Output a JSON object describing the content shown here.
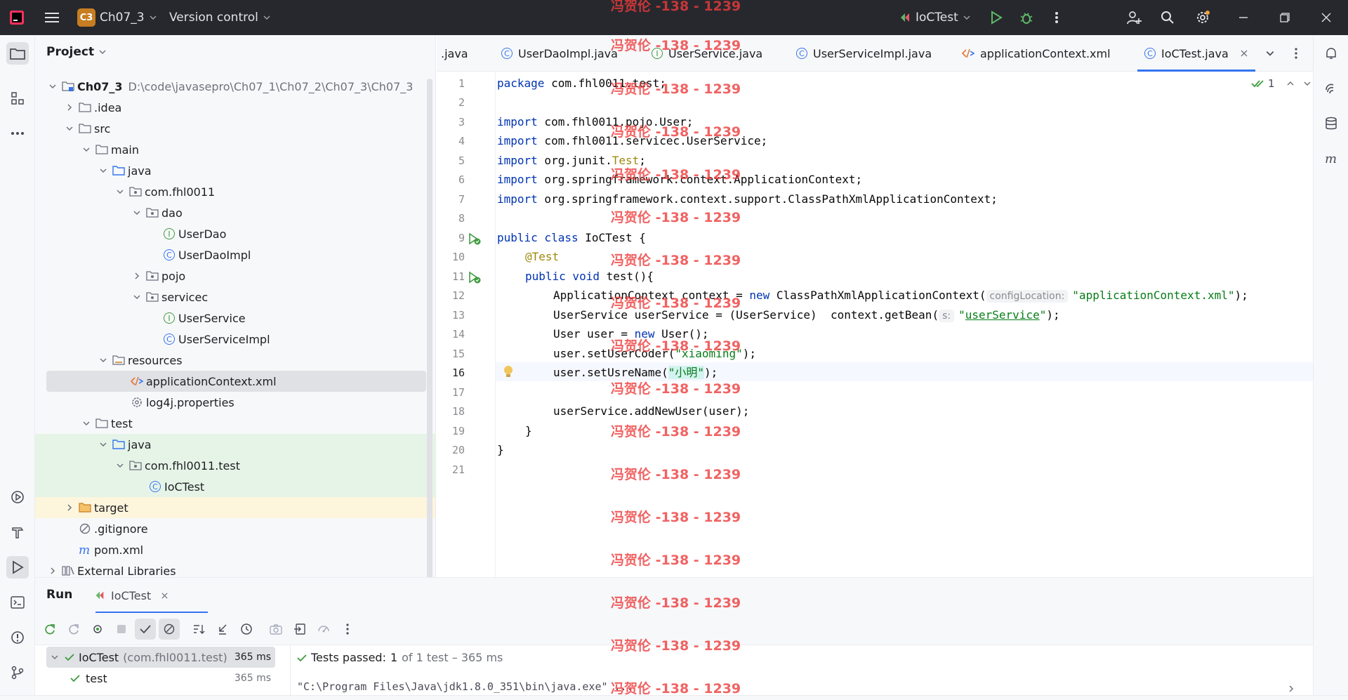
{
  "titlebar": {
    "project_badge": "C3",
    "project_name": "Ch07_3",
    "vcs_label": "Version control",
    "run_config": "IoCTest"
  },
  "project_panel": {
    "title": "Project",
    "tree": [
      {
        "label": "Ch07_3",
        "path": "D:\\code\\javasepro\\Ch07_1\\Ch07_2\\Ch07_3\\Ch07_3"
      },
      {
        "label": ".idea"
      },
      {
        "label": "src"
      },
      {
        "label": "main"
      },
      {
        "label": "java"
      },
      {
        "label": "com.fhl0011"
      },
      {
        "label": "dao"
      },
      {
        "label": "UserDao"
      },
      {
        "label": "UserDaoImpl"
      },
      {
        "label": "pojo"
      },
      {
        "label": "servicec"
      },
      {
        "label": "UserService"
      },
      {
        "label": "UserServiceImpl"
      },
      {
        "label": "resources"
      },
      {
        "label": "applicationContext.xml"
      },
      {
        "label": "log4j.properties"
      },
      {
        "label": "test"
      },
      {
        "label": "java"
      },
      {
        "label": "com.fhl0011.test"
      },
      {
        "label": "IoCTest"
      },
      {
        "label": "target"
      },
      {
        "label": ".gitignore"
      },
      {
        "label": "pom.xml"
      },
      {
        "label": "External Libraries"
      }
    ]
  },
  "editor": {
    "tabs": [
      {
        "label": ".java"
      },
      {
        "label": "UserDaoImpl.java"
      },
      {
        "label": "UserService.java"
      },
      {
        "label": "UserServiceImpl.java"
      },
      {
        "label": "applicationContext.xml"
      },
      {
        "label": "IoCTest.java"
      }
    ],
    "inspection_count": "1",
    "line_numbers": [
      "1",
      "2",
      "3",
      "4",
      "5",
      "6",
      "7",
      "8",
      "9",
      "10",
      "11",
      "12",
      "13",
      "14",
      "15",
      "16",
      "17",
      "18",
      "19",
      "20",
      "21"
    ],
    "code": {
      "l1_kw": "package",
      "l1_rest": " com.fhl0011.test;",
      "l3_kw": "import",
      "l3_rest": " com.fhl0011.pojo.User;",
      "l4_kw": "import",
      "l4_rest": " com.fhl0011.servicec.UserService;",
      "l5_kw": "import",
      "l5_a": " org.junit.",
      "l5_ann": "Test",
      "l5_b": ";",
      "l6_kw": "import",
      "l6_rest": " org.springframework.context.ApplicationContext;",
      "l7_kw": "import",
      "l7_rest": " org.springframework.context.support.ClassPathXmlApplicationContext;",
      "l9_kw": "public class",
      "l9_rest": " IoCTest {",
      "l10_ann": "@Test",
      "l11_kw": "public void",
      "l11_rest": " test(){",
      "l12_a": "ApplicationContext context = ",
      "l12_kw": "new",
      "l12_b": " ClassPathXmlApplicationContext(",
      "l12_hint": "configLocation:",
      "l12_str": "\"applicationContext.xml\"",
      "l12_c": ");",
      "l13_a": "UserService userService = (UserService)  context.getBean(",
      "l13_hint": "s:",
      "l13_q1": "\"",
      "l13_link": "userService",
      "l13_q2": "\"",
      "l13_c": ");",
      "l14_a": "User user = ",
      "l14_kw": "new",
      "l14_b": " User();",
      "l15_a": "user.setUserCoder(",
      "l15_str": "\"xiaoming\"",
      "l15_b": ");",
      "l16_a": "user.setUsreName(",
      "l16_str": "\"小明\"",
      "l16_b": ");",
      "l18_a": "userService.addNewUser(user);",
      "l19": "}",
      "l20": "}"
    }
  },
  "run_panel": {
    "title": "Run",
    "tab_label": "IoCTest",
    "tree": [
      {
        "label": "IoCTest",
        "detail": "(com.fhl0011.test)",
        "time": "365 ms"
      },
      {
        "label": "test",
        "time": "365 ms"
      }
    ],
    "status_prefix": "Tests passed:",
    "status_count": "1",
    "status_suffix": "of 1 test – 365 ms",
    "console_line": "\"C:\\Program Files\\Java\\jdk1.8.0_351\\bin\\java.exe\" ..."
  },
  "watermark": "冯贺伦 -138 - 1239",
  "colors": {
    "accent": "#3574f0",
    "titlebar_bg": "#27282e",
    "keyword": "#0033b3",
    "string": "#067d17",
    "annotation": "#9e880d",
    "pass_green": "#3e9b3e"
  }
}
